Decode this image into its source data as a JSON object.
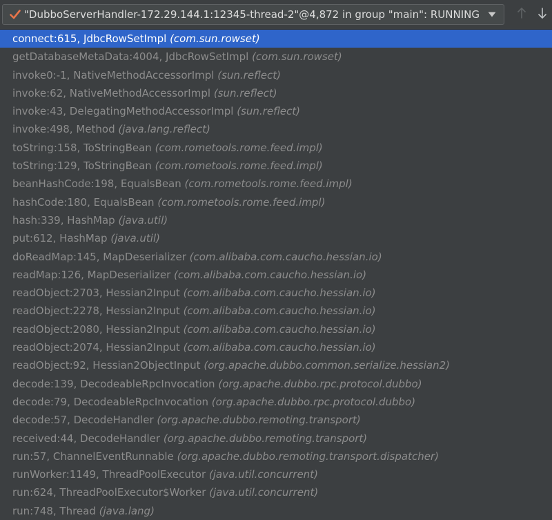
{
  "thread_selector": {
    "label": "\"DubboServerHandler-172.29.144.1:12345-thread-2\"@4,872 in group \"main\": RUNNING",
    "status_icon": "check-icon",
    "accent_color": "#e9754a"
  },
  "nav": {
    "up_icon": "arrow-up-icon",
    "down_icon": "arrow-down-icon"
  },
  "selection_color": "#2f65ca",
  "frames": [
    {
      "method": "connect:615, JdbcRowSetImpl",
      "package": "(com.sun.rowset)"
    },
    {
      "method": "getDatabaseMetaData:4004, JdbcRowSetImpl",
      "package": "(com.sun.rowset)"
    },
    {
      "method": "invoke0:-1, NativeMethodAccessorImpl",
      "package": "(sun.reflect)"
    },
    {
      "method": "invoke:62, NativeMethodAccessorImpl",
      "package": "(sun.reflect)"
    },
    {
      "method": "invoke:43, DelegatingMethodAccessorImpl",
      "package": "(sun.reflect)"
    },
    {
      "method": "invoke:498, Method",
      "package": "(java.lang.reflect)"
    },
    {
      "method": "toString:158, ToStringBean",
      "package": "(com.rometools.rome.feed.impl)"
    },
    {
      "method": "toString:129, ToStringBean",
      "package": "(com.rometools.rome.feed.impl)"
    },
    {
      "method": "beanHashCode:198, EqualsBean",
      "package": "(com.rometools.rome.feed.impl)"
    },
    {
      "method": "hashCode:180, EqualsBean",
      "package": "(com.rometools.rome.feed.impl)"
    },
    {
      "method": "hash:339, HashMap",
      "package": "(java.util)"
    },
    {
      "method": "put:612, HashMap",
      "package": "(java.util)"
    },
    {
      "method": "doReadMap:145, MapDeserializer",
      "package": "(com.alibaba.com.caucho.hessian.io)"
    },
    {
      "method": "readMap:126, MapDeserializer",
      "package": "(com.alibaba.com.caucho.hessian.io)"
    },
    {
      "method": "readObject:2703, Hessian2Input",
      "package": "(com.alibaba.com.caucho.hessian.io)"
    },
    {
      "method": "readObject:2278, Hessian2Input",
      "package": "(com.alibaba.com.caucho.hessian.io)"
    },
    {
      "method": "readObject:2080, Hessian2Input",
      "package": "(com.alibaba.com.caucho.hessian.io)"
    },
    {
      "method": "readObject:2074, Hessian2Input",
      "package": "(com.alibaba.com.caucho.hessian.io)"
    },
    {
      "method": "readObject:92, Hessian2ObjectInput",
      "package": "(org.apache.dubbo.common.serialize.hessian2)"
    },
    {
      "method": "decode:139, DecodeableRpcInvocation",
      "package": "(org.apache.dubbo.rpc.protocol.dubbo)"
    },
    {
      "method": "decode:79, DecodeableRpcInvocation",
      "package": "(org.apache.dubbo.rpc.protocol.dubbo)"
    },
    {
      "method": "decode:57, DecodeHandler",
      "package": "(org.apache.dubbo.remoting.transport)"
    },
    {
      "method": "received:44, DecodeHandler",
      "package": "(org.apache.dubbo.remoting.transport)"
    },
    {
      "method": "run:57, ChannelEventRunnable",
      "package": "(org.apache.dubbo.remoting.transport.dispatcher)"
    },
    {
      "method": "runWorker:1149, ThreadPoolExecutor",
      "package": "(java.util.concurrent)"
    },
    {
      "method": "run:624, ThreadPoolExecutor$Worker",
      "package": "(java.util.concurrent)"
    },
    {
      "method": "run:748, Thread",
      "package": "(java.lang)"
    }
  ]
}
